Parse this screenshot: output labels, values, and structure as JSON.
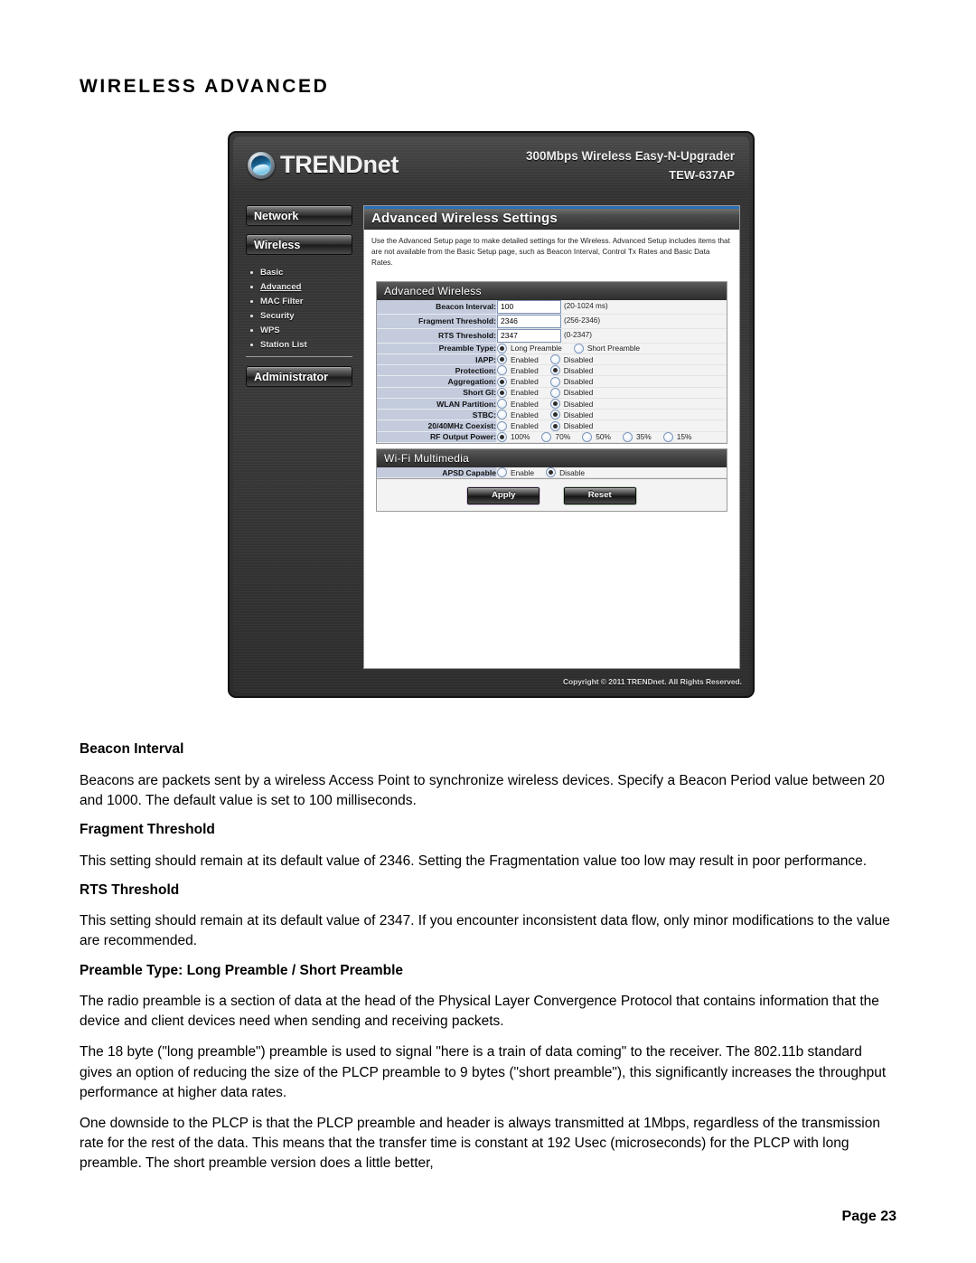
{
  "page_heading": "WIRELESS ADVANCED",
  "page_number_label": "Page  23",
  "screenshot": {
    "brand": {
      "logo_text": "TRENDnet",
      "logo_icon": "trendnet-globe-icon",
      "model_name": "300Mbps Wireless Easy-N-Upgrader",
      "model_code": "TEW-637AP"
    },
    "sidebar": {
      "buttons": [
        {
          "label": "Network"
        },
        {
          "label": "Wireless"
        },
        {
          "label": "Administrator"
        }
      ],
      "wireless_items": [
        {
          "label": "Basic",
          "active": false
        },
        {
          "label": "Advanced",
          "active": true
        },
        {
          "label": "MAC Filter",
          "active": false
        },
        {
          "label": "Security",
          "active": false
        },
        {
          "label": "WPS",
          "active": false
        },
        {
          "label": "Station List",
          "active": false
        }
      ]
    },
    "content": {
      "title": "Advanced Wireless Settings",
      "intro": "Use the Advanced Setup page to make detailed settings for the Wireless. Advanced Setup includes items that are not available from the Basic Setup page, such as Beacon Interval, Control Tx Rates and Basic Data Rates.",
      "advanced_panel": {
        "title": "Advanced Wireless",
        "text_rows": [
          {
            "label": "Beacon Interval:",
            "value": "100",
            "hint": "(20-1024 ms)"
          },
          {
            "label": "Fragment Threshold:",
            "value": "2346",
            "hint": "(256-2346)"
          },
          {
            "label": "RTS Threshold:",
            "value": "2347",
            "hint": "(0-2347)"
          }
        ],
        "radio_rows": [
          {
            "label": "Preamble Type:",
            "options": [
              {
                "label": "Long Preamble",
                "selected": true
              },
              {
                "label": "Short Preamble",
                "selected": false
              }
            ]
          },
          {
            "label": "IAPP:",
            "options": [
              {
                "label": "Enabled",
                "selected": true
              },
              {
                "label": "Disabled",
                "selected": false
              }
            ]
          },
          {
            "label": "Protection:",
            "options": [
              {
                "label": "Enabled",
                "selected": false
              },
              {
                "label": "Disabled",
                "selected": true
              }
            ]
          },
          {
            "label": "Aggregation:",
            "options": [
              {
                "label": "Enabled",
                "selected": true
              },
              {
                "label": "Disabled",
                "selected": false
              }
            ]
          },
          {
            "label": "Short GI:",
            "options": [
              {
                "label": "Enabled",
                "selected": true
              },
              {
                "label": "Disabled",
                "selected": false
              }
            ]
          },
          {
            "label": "WLAN Partition:",
            "options": [
              {
                "label": "Enabled",
                "selected": false
              },
              {
                "label": "Disabled",
                "selected": true
              }
            ]
          },
          {
            "label": "STBC:",
            "options": [
              {
                "label": "Enabled",
                "selected": false
              },
              {
                "label": "Disabled",
                "selected": true
              }
            ]
          },
          {
            "label": "20/40MHz Coexist:",
            "options": [
              {
                "label": "Enabled",
                "selected": false
              },
              {
                "label": "Disabled",
                "selected": true
              }
            ]
          },
          {
            "label": "RF Output Power:",
            "options": [
              {
                "label": "100%",
                "selected": true
              },
              {
                "label": "70%",
                "selected": false
              },
              {
                "label": "50%",
                "selected": false
              },
              {
                "label": "35%",
                "selected": false
              },
              {
                "label": "15%",
                "selected": false
              }
            ]
          }
        ]
      },
      "wmm_panel": {
        "title": "Wi-Fi Multimedia",
        "radio_rows": [
          {
            "label": "APSD Capable",
            "options": [
              {
                "label": "Enable",
                "selected": false
              },
              {
                "label": "Disable",
                "selected": true
              }
            ]
          }
        ]
      },
      "buttons": {
        "apply": "Apply",
        "reset": "Reset"
      },
      "copyright": "Copyright © 2011 TRENDnet. All Rights Reserved."
    }
  },
  "body": {
    "sections": [
      {
        "heading": "Beacon Interval",
        "paragraphs": [
          "Beacons are packets sent by a wireless Access Point to synchronize wireless devices. Specify a Beacon Period value between 20 and 1000. The default value is set to 100 milliseconds."
        ]
      },
      {
        "heading": "Fragment Threshold",
        "paragraphs": [
          "This setting should remain at its default value of 2346. Setting the Fragmentation value too low may result in poor performance."
        ]
      },
      {
        "heading": "RTS Threshold",
        "paragraphs": [
          "This setting should remain at its default value of 2347. If you encounter inconsistent data flow, only minor modifications to the value are recommended."
        ]
      },
      {
        "heading": "Preamble Type: Long Preamble  / Short Preamble",
        "paragraphs": [
          "The radio preamble is a section of data at the head of the Physical Layer Convergence Protocol that contains information that the device and client devices need when sending and receiving packets.",
          "The 18 byte (\"long preamble\") preamble is used to signal \"here is a train of data coming\" to the receiver. The 802.11b standard gives an option of reducing the size of the PLCP preamble to 9 bytes (\"short preamble\"), this significantly increases the throughput performance at higher data rates.",
          "One downside to the PLCP is that the PLCP preamble and header is always transmitted at 1Mbps, regardless of the transmission rate for the rest of the data. This means that the transfer time is constant at 192 Usec (microseconds) for the PLCP with long preamble. The short preamble version does a little better,"
        ]
      }
    ]
  }
}
